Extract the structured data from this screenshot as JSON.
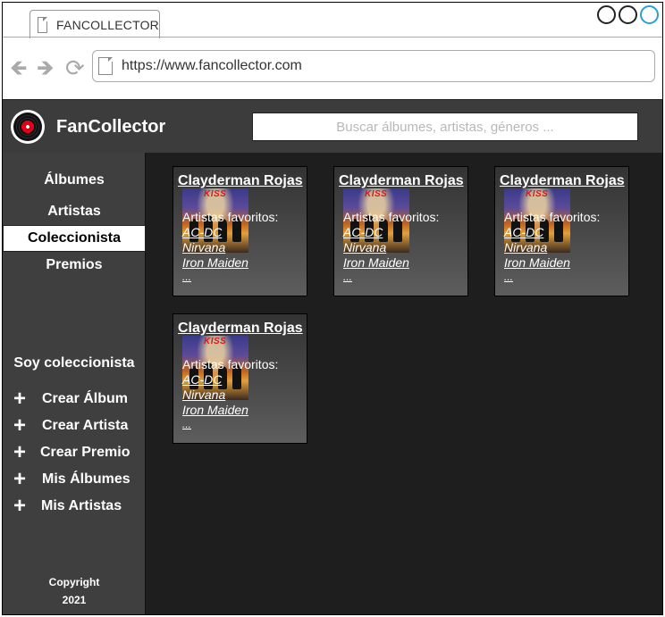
{
  "browser": {
    "tab_title": "FANCOLLECTOR",
    "url": "https://www.fancollector.com",
    "back_icon": "arrow-left-icon",
    "forward_icon": "arrow-right-icon",
    "refresh_icon": "refresh-icon"
  },
  "header": {
    "app_name": "FanCollector",
    "search_placeholder": "Buscar álbumes, artistas, géneros ..."
  },
  "sidebar": {
    "nav": [
      {
        "label": "Álbumes"
      },
      {
        "label": "Artistas"
      },
      {
        "label": "Coleccionista",
        "active": true
      },
      {
        "label": "Premios"
      }
    ],
    "section_title": "Soy coleccionista",
    "actions": [
      {
        "label": "Crear Álbum"
      },
      {
        "label": "Crear Artista"
      },
      {
        "label": "Crear Premio"
      },
      {
        "label": "Mis Álbumes"
      },
      {
        "label": "Mis Artistas"
      }
    ],
    "copyright_line1": "Copyright",
    "copyright_line2": "2021"
  },
  "collectors": [
    {
      "name": "Clayderman Rojas",
      "cover_text": "KISS",
      "favorites_label": "Artistas favoritos:",
      "artists": [
        "AC-DC",
        "Nirvana",
        "Iron Maiden"
      ],
      "more": "..."
    },
    {
      "name": "Clayderman Rojas",
      "cover_text": "KISS",
      "favorites_label": "Artistas favoritos:",
      "artists": [
        "AC-DC",
        "Nirvana",
        "Iron Maiden"
      ],
      "more": "..."
    },
    {
      "name": "Clayderman Rojas",
      "cover_text": "KISS",
      "favorites_label": "Artistas favoritos:",
      "artists": [
        "AC-DC",
        "Nirvana",
        "Iron Maiden"
      ],
      "more": "..."
    },
    {
      "name": "Clayderman Rojas",
      "cover_text": "KISS",
      "favorites_label": "Artistas favoritos:",
      "artists": [
        "AC-DC",
        "Nirvana",
        "Iron Maiden"
      ],
      "more": "..."
    }
  ]
}
